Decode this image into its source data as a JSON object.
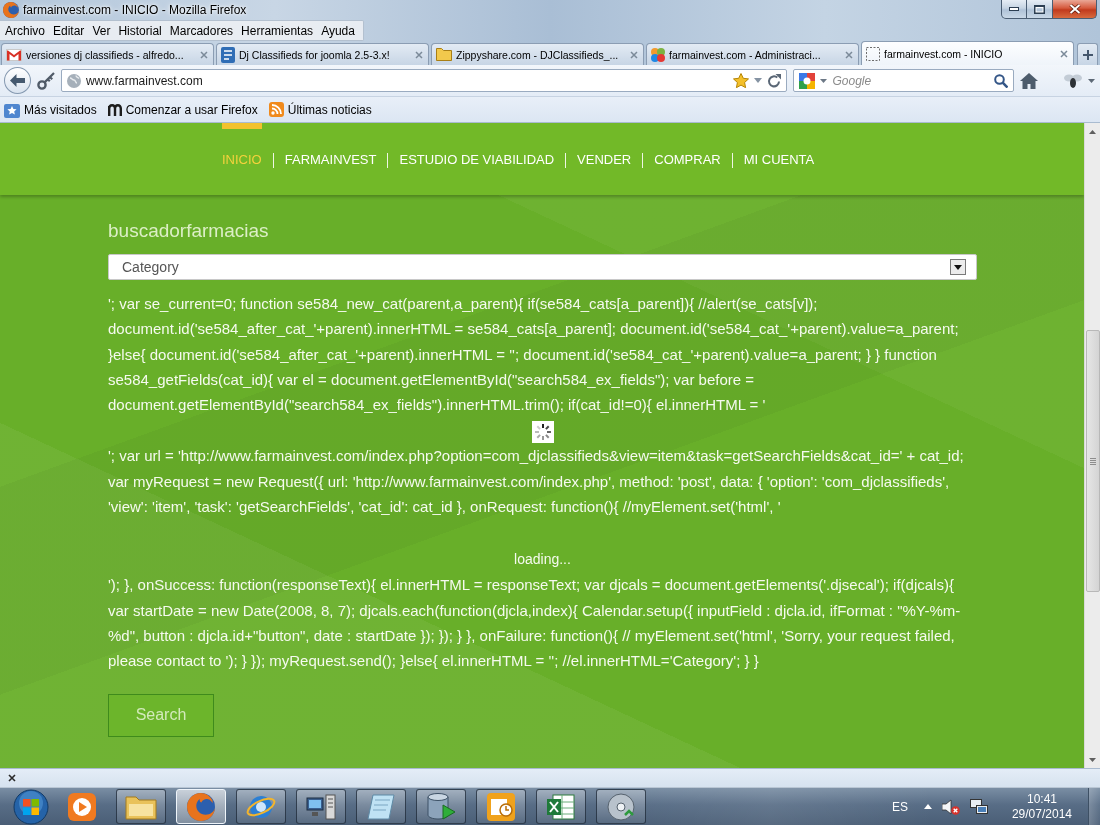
{
  "window": {
    "title": "farmainvest.com - INICIO - Mozilla Firefox"
  },
  "menu_bar": [
    "Archivo",
    "Editar",
    "Ver",
    "Historial",
    "Marcadores",
    "Herramientas",
    "Ayuda"
  ],
  "tabs": [
    {
      "label": "versiones dj classifieds - alfredo...",
      "selected": false
    },
    {
      "label": "Dj Classifieds for joomla 2.5-3.x!",
      "selected": false
    },
    {
      "label": "Zippyshare.com - DJClassifieds_...",
      "selected": false
    },
    {
      "label": "farmainvest.com - Administraci...",
      "selected": false
    },
    {
      "label": "farmainvest.com - INICIO",
      "selected": true
    }
  ],
  "address_bar": {
    "value": "www.farmainvest.com"
  },
  "search_bar": {
    "placeholder": "Google"
  },
  "bookmarks": [
    "Más visitados",
    "Comenzar a usar Firefox",
    "Últimas noticias"
  ],
  "page": {
    "nav": [
      {
        "label": "INICIO",
        "selected": true
      },
      {
        "label": "FARMAINVEST",
        "selected": false
      },
      {
        "label": "ESTUDIO DE VIABILIDAD",
        "selected": false
      },
      {
        "label": "VENDER",
        "selected": false
      },
      {
        "label": "COMPRAR",
        "selected": false
      },
      {
        "label": "MI CUENTA",
        "selected": false
      }
    ],
    "module_title": "buscadorfarmacias",
    "category_select": {
      "value": "Category"
    },
    "content": [
      {
        "kind": "code",
        "text": "'; var se_current=0; function se584_new_cat(parent,a_parent){ if(se584_cats[a_parent]){ //alert(se_cats[v]); document.id('se584_after_cat_'+parent).innerHTML = se584_cats[a_parent]; document.id('se584_cat_'+parent).value=a_parent; }else{ document.id('se584_after_cat_'+parent).innerHTML = ''; document.id('se584_cat_'+parent).value=a_parent; } } function se584_getFields(cat_id){ var el = document.getElementById(\"search584_ex_fields\"); var before = document.getElementById(\"search584_ex_fields\").innerHTML.trim(); if(cat_id!=0){ el.innerHTML = '"
      },
      {
        "kind": "spinner"
      },
      {
        "kind": "code",
        "text": "'; var url = 'http://www.farmainvest.com/index.php?option=com_djclassifieds&view=item&task=getSearchFields&cat_id=' + cat_id; var myRequest = new Request({ url: 'http://www.farmainvest.com/index.php', method: 'post', data: { 'option': 'com_djclassifieds', 'view': 'item', 'task': 'getSearchFields', 'cat_id': cat_id }, onRequest: function(){ //myElement.set('html', '"
      },
      {
        "kind": "loading",
        "text": "loading..."
      },
      {
        "kind": "code",
        "text": "'); }, onSuccess: function(responseText){ el.innerHTML = responseText; var djcals = document.getElements('.djsecal'); if(djcals){ var startDate = new Date(2008, 8, 7); djcals.each(function(djcla,index){ Calendar.setup({ inputField : djcla.id, ifFormat : \"%Y-%m-%d\", button : djcla.id+\"button\", date : startDate }); }); } }, onFailure: function(){ // myElement.set('html', 'Sorry, your request failed, please contact to '); } }); myRequest.send(); }else{ el.innerHTML = ''; //el.innerHTML='Category'; } }"
      }
    ],
    "search_button": "Search"
  },
  "taskbar": {
    "apps": [
      {
        "running": false,
        "selected": false
      },
      {
        "running": true,
        "selected": false
      },
      {
        "running": true,
        "selected": true
      },
      {
        "running": true,
        "selected": false
      },
      {
        "running": true,
        "selected": false
      },
      {
        "running": true,
        "selected": false
      },
      {
        "running": true,
        "selected": false
      },
      {
        "running": true,
        "selected": false
      },
      {
        "running": true,
        "selected": false
      },
      {
        "running": true,
        "selected": false
      }
    ],
    "language": "ES",
    "time": "10:41",
    "date": "29/07/2014"
  }
}
